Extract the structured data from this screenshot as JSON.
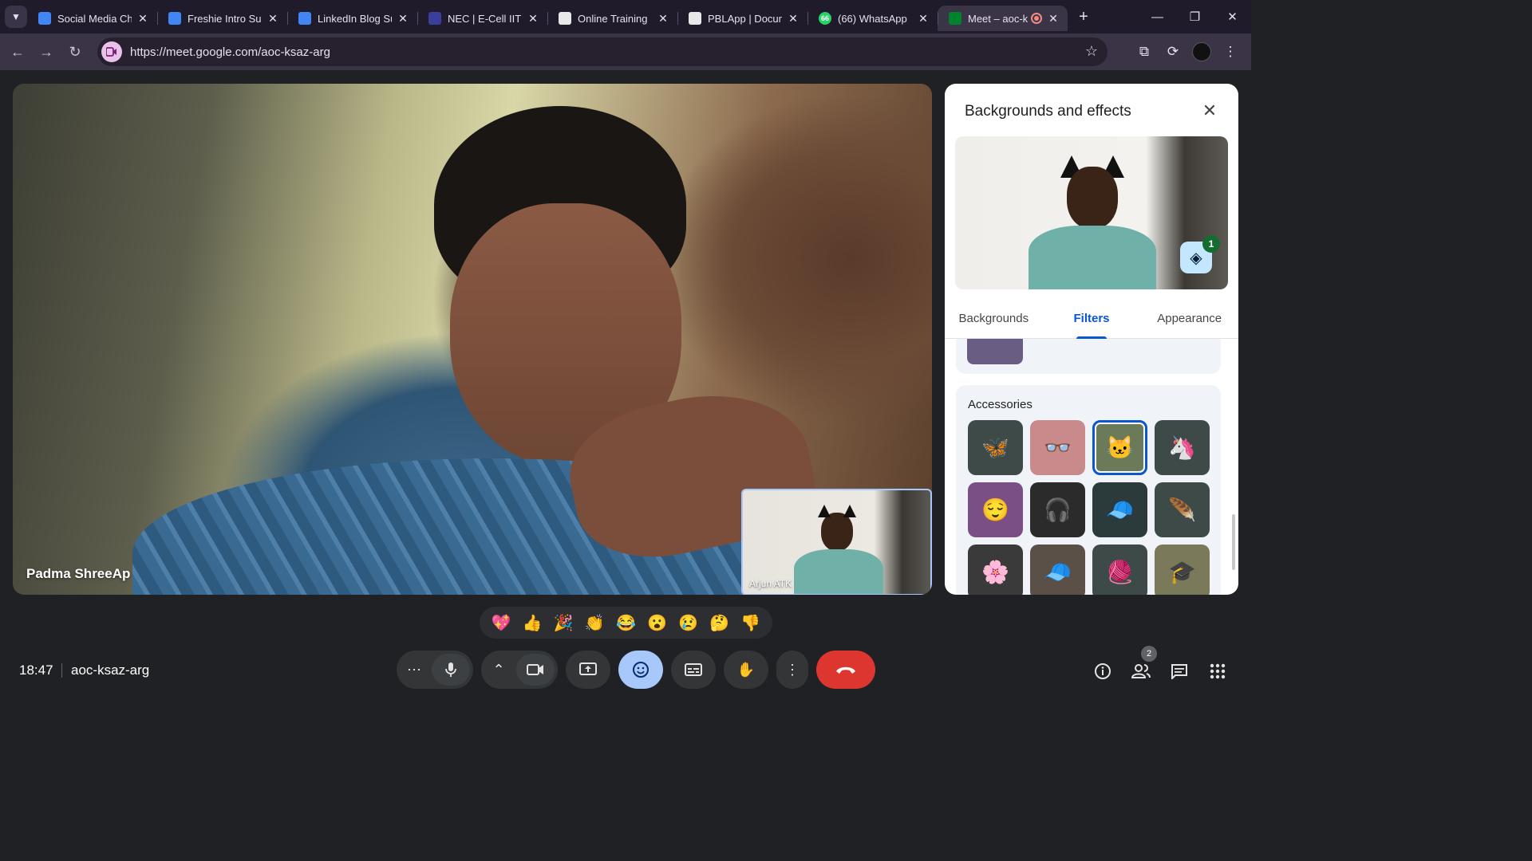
{
  "browser": {
    "tabs": [
      {
        "title": "Social Media Cha",
        "favicon_color": "#4285f4"
      },
      {
        "title": "Freshie Intro Sub",
        "favicon_color": "#4285f4"
      },
      {
        "title": "LinkedIn Blog Su",
        "favicon_color": "#4285f4"
      },
      {
        "title": "NEC | E-Cell IIT B",
        "favicon_color": "#3b3e9a"
      },
      {
        "title": "Online Training",
        "favicon_color": "#e8e8e8"
      },
      {
        "title": "PBLApp | Docum",
        "favicon_color": "#e8e8e8"
      },
      {
        "title": "(66) WhatsApp",
        "favicon_color": "#25d366",
        "badge": "66"
      },
      {
        "title": "Meet – aoc-k",
        "favicon_color": "#00832d",
        "active": true
      }
    ],
    "url": "https://meet.google.com/aoc-ksaz-arg"
  },
  "meet": {
    "main_participant": "Padma ShreeAp",
    "self_view_name": "Arjun ATK",
    "clock": "18:47",
    "meeting_code": "aoc-ksaz-arg",
    "participant_count": "2",
    "reactions": [
      "💖",
      "👍",
      "🎉",
      "👏",
      "😂",
      "😮",
      "😢",
      "🤔",
      "👎"
    ]
  },
  "panel": {
    "title": "Backgrounds and effects",
    "effects_count": "1",
    "tabs": [
      "Backgrounds",
      "Filters",
      "Appearance"
    ],
    "active_tab": "Filters",
    "section_title": "Accessories",
    "accessories": [
      {
        "name": "butterflies",
        "glyph": "🦋",
        "bg": "#3d4a48"
      },
      {
        "name": "beret-glasses",
        "glyph": "👓",
        "bg": "#c88a8a"
      },
      {
        "name": "cat-ears-glasses",
        "glyph": "🐱",
        "bg": "#6b7a58",
        "selected": true
      },
      {
        "name": "unicorn-headband",
        "glyph": "🦄",
        "bg": "#3d4a48"
      },
      {
        "name": "sleepy-face",
        "glyph": "😌",
        "bg": "#7a4f86"
      },
      {
        "name": "cat-headphones",
        "glyph": "🎧",
        "bg": "#2b2b2b"
      },
      {
        "name": "cap",
        "glyph": "🧢",
        "bg": "#2b3a3a"
      },
      {
        "name": "feather-clip",
        "glyph": "🪶",
        "bg": "#3d4a48"
      },
      {
        "name": "flowers",
        "glyph": "🌸",
        "bg": "#3a3a3a"
      },
      {
        "name": "baseball-cap",
        "glyph": "🧢",
        "bg": "#5a5048"
      },
      {
        "name": "beanie",
        "glyph": "🧶",
        "bg": "#3d4a48"
      },
      {
        "name": "graduation-cap",
        "glyph": "🎓",
        "bg": "#7a7a5a"
      }
    ]
  }
}
